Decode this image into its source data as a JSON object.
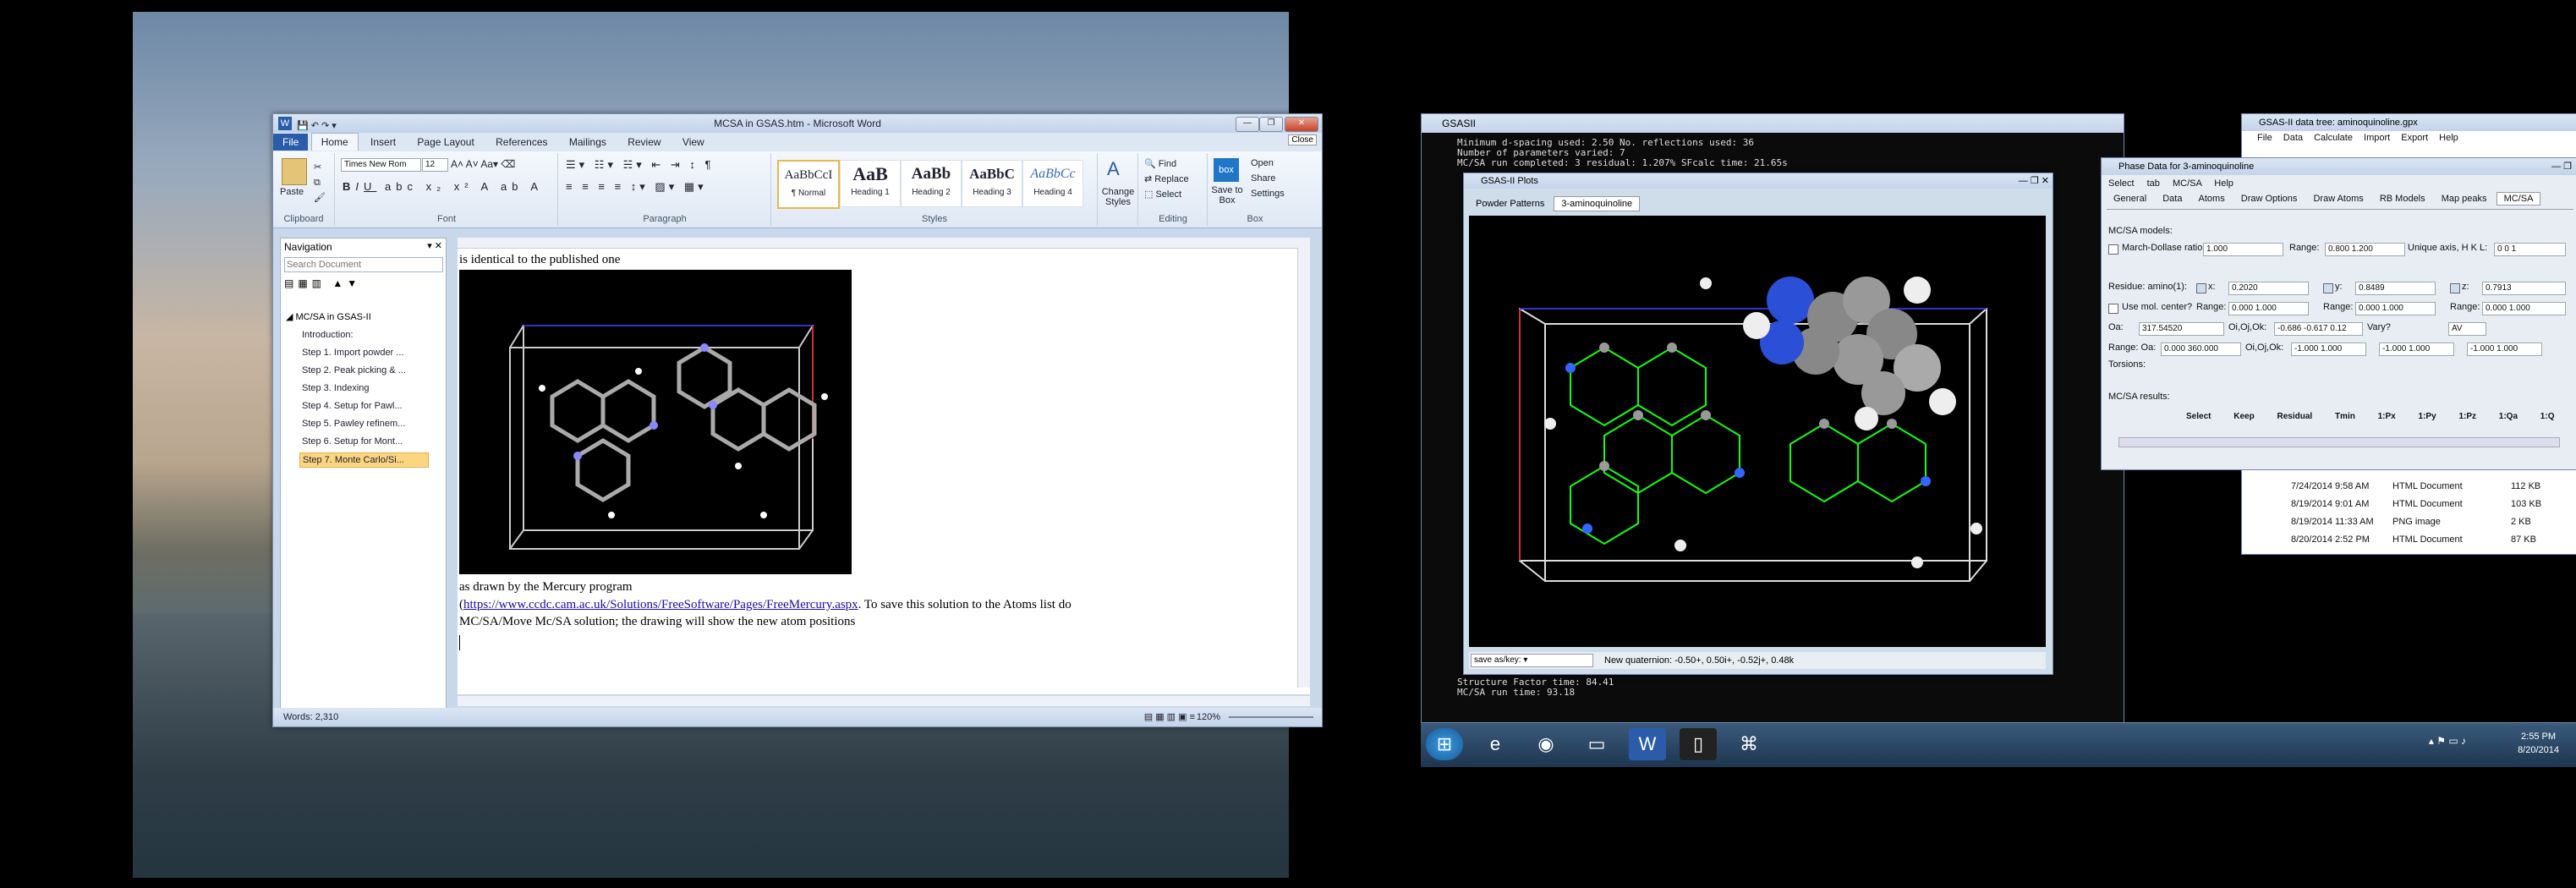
{
  "word": {
    "title": "MCSA in GSAS.htm - Microsoft Word",
    "tabs": [
      "File",
      "Home",
      "Insert",
      "Page Layout",
      "References",
      "Mailings",
      "Review",
      "View"
    ],
    "close_tooltip": "Close",
    "clipboard": {
      "paste": "Paste",
      "group": "Clipboard"
    },
    "font": {
      "name": "Times New Rom",
      "size": "12",
      "group": "Font"
    },
    "paragraph_group": "Paragraph",
    "styles": [
      {
        "sample": "AaBbCcI",
        "name": "¶ Normal"
      },
      {
        "sample": "AaB",
        "name": "Heading 1"
      },
      {
        "sample": "AaBb",
        "name": "Heading 2"
      },
      {
        "sample": "AaBbC",
        "name": "Heading 3"
      },
      {
        "sample": "AaBbCc",
        "name": "Heading 4"
      }
    ],
    "styles_group": "Styles",
    "change_styles": "Change Styles",
    "editing": {
      "find": "Find",
      "replace": "Replace",
      "select": "Select",
      "group": "Editing"
    },
    "box": {
      "save_to_box": "Save to Box",
      "open": "Open",
      "share": "Share",
      "settings": "Settings",
      "group": "Box"
    },
    "navigation": {
      "title": "Navigation",
      "search_placeholder": "Search Document",
      "root": "MC/SA in GSAS-II",
      "items": [
        "Introduction:",
        "Step 1. Import powder ...",
        "Step 2. Peak picking & ...",
        "Step 3. Indexing",
        "Step 4. Setup for Pawl...",
        "Step 5. Pawley refinem...",
        "Step 6. Setup for Mont...",
        "Step 7. Monte Carlo/Si..."
      ]
    },
    "doc": {
      "line1": "is identical to the published one",
      "caption": "as drawn by the Mercury program",
      "link": "https://www.ccdc.cam.ac.uk/Solutions/FreeSoftware/Pages/FreeMercury.aspx",
      "after_link": ". To save this solution to the Atoms list do",
      "line3": "MC/SA/Move Mc/SA solution; the drawing will show the new atom positions"
    },
    "status": {
      "words": "Words: 2,310",
      "zoom": "120%"
    }
  },
  "gsas": {
    "title": "GSASII",
    "console_top": [
      "Minimum d-spacing used: 2.50 No. reflections used: 36",
      "Number of parameters varied: 7",
      "MC/SA run completed: 3 residual: 1.207% SFcalc time: 21.65s"
    ],
    "console_bottom": [
      "Structure Factor time: 84.41",
      "MC/SA run time: 93.18"
    ],
    "plot": {
      "title": "GSAS-II Plots",
      "tabs": [
        "Powder Patterns",
        "3-aminoquinoline"
      ],
      "save_label": "save as/key:",
      "status": "New quaternion: -0.50+, 0.50i+, -0.52j+, 0.48k"
    }
  },
  "phase": {
    "title": "Phase Data for 3-aminoquinoline",
    "menu": [
      "Select tab",
      "MC/SA",
      "Help"
    ],
    "tabs": [
      "General",
      "Data",
      "Atoms",
      "Draw Options",
      "Draw Atoms",
      "RB Models",
      "Map peaks",
      "MC/SA"
    ],
    "models_label": "MC/SA models:",
    "march_label": "March-Dollase ratio:",
    "march_value": "1.000",
    "range_label": "Range:",
    "march_range": "0.800 1.200",
    "unique_label": "Unique axis, H K L:",
    "unique_value": "0  0  1",
    "residue_label": "Residue: amino(1):",
    "x_label": "x:",
    "x": "0.2020",
    "y_label": "y:",
    "y": "0.8489",
    "z_label": "z:",
    "z": "0.7913",
    "use_mol": "Use mol. center?",
    "range_x": "0.000 1.000",
    "range_y": "0.000 1.000",
    "range_z": "0.000 1.000",
    "oa_label": "Oa:",
    "oa": "317.54520",
    "oo_label": "Oi,Oj,Ok:",
    "oo": "-0.686 -0.617 0.12",
    "vary_label": "Vary?",
    "vary": "AV",
    "range_oa_label": "Range: Oa:",
    "range_oa": "0.000 360.000",
    "range_oo_label": "Oi,Oj,Ok:",
    "range_oo": [
      "-1.000 1.000",
      "-1.000 1.000",
      "-1.000 1.000"
    ],
    "torsions": "Torsions:",
    "results_label": "MC/SA results:",
    "results_cols": [
      "Select",
      "Keep",
      "Residual",
      "Tmin",
      "1:Px",
      "1:Py",
      "1:Pz",
      "1:Qa",
      "1:Q"
    ]
  },
  "tree": {
    "title": "GSAS-II data tree: aminoquinoline.gpx",
    "menu": [
      "File",
      "Data",
      "Calculate",
      "Import",
      "Export",
      "Help"
    ],
    "rows": [
      {
        "date": "7/24/2014 9:58 AM",
        "type": "HTML Document",
        "size": "112 KB"
      },
      {
        "date": "8/19/2014 9:01 AM",
        "type": "HTML Document",
        "size": "103 KB"
      },
      {
        "date": "8/19/2014 11:33 AM",
        "type": "PNG image",
        "size": "2 KB"
      },
      {
        "date": "8/20/2014 2:52 PM",
        "type": "HTML Document",
        "size": "87 KB"
      }
    ]
  },
  "taskbar": {
    "time": "2:55 PM",
    "date": "8/20/2014"
  }
}
